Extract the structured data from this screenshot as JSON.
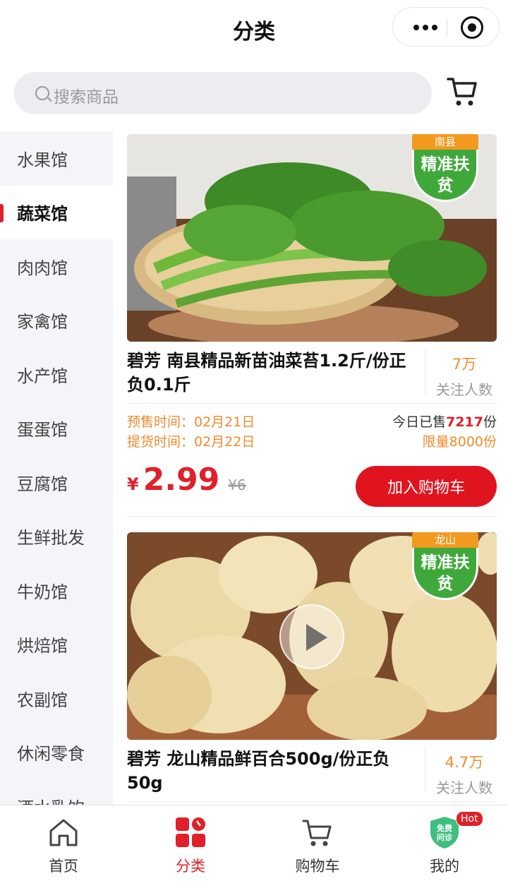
{
  "header": {
    "title": "分类"
  },
  "search": {
    "placeholder": "搜索商品"
  },
  "sidebar": {
    "items": [
      {
        "label": "水果馆"
      },
      {
        "label": "蔬菜馆",
        "active": true
      },
      {
        "label": "肉肉馆"
      },
      {
        "label": "家禽馆"
      },
      {
        "label": "水产馆"
      },
      {
        "label": "蛋蛋馆"
      },
      {
        "label": "豆腐馆"
      },
      {
        "label": "生鲜批发"
      },
      {
        "label": "牛奶馆"
      },
      {
        "label": "烘焙馆"
      },
      {
        "label": "农副馆"
      },
      {
        "label": "休闲零食"
      },
      {
        "label": "酒水乳饮"
      }
    ]
  },
  "products": [
    {
      "badge_region": "南县",
      "badge_text": "精准扶贫",
      "title": "碧芳 南县精品新苗油菜苔1.2斤/份正负0.1斤",
      "fans_count": "7万",
      "fans_label": "关注人数",
      "presale_time": "预售时间：02月21日",
      "pickup_time": "提货时间：02月22日",
      "sold_prefix": "今日已售",
      "sold_count": "7217",
      "sold_suffix": "份",
      "limit": "限量8000份",
      "currency": "¥",
      "price": "2.99",
      "original_price": "¥6",
      "add_to_cart": "加入购物车"
    },
    {
      "badge_region": "龙山",
      "badge_text": "精准扶贫",
      "title": "碧芳 龙山精品鲜百合500g/份正负50g",
      "fans_count": "4.7万",
      "fans_label": "关注人数"
    }
  ],
  "tabbar": {
    "tabs": [
      {
        "label": "首页",
        "icon": "home-icon"
      },
      {
        "label": "分类",
        "icon": "category-icon",
        "active": true
      },
      {
        "label": "购物车",
        "icon": "cart-icon"
      },
      {
        "label": "我的",
        "icon": "consult-shield-icon",
        "badge": "Hot",
        "icon_text": "免费问诊"
      }
    ]
  },
  "colors": {
    "accent": "#e0202a",
    "orange": "#f08a2c",
    "badge_green": "#3ea93a"
  }
}
